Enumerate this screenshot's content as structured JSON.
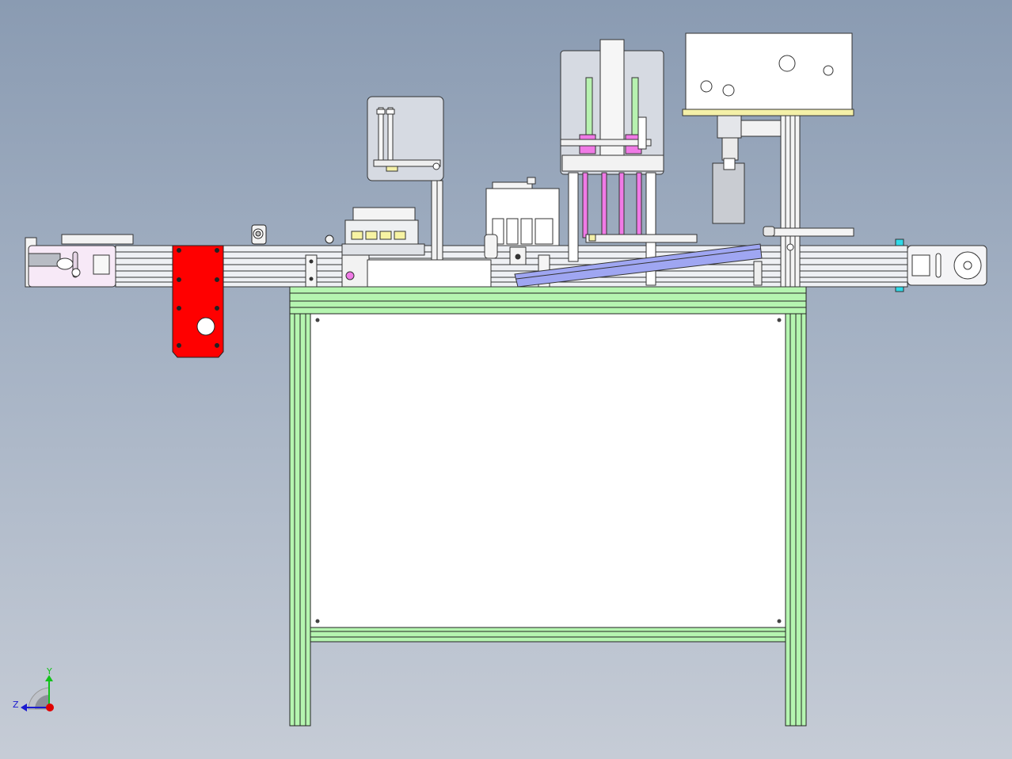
{
  "drawing": {
    "view": "front",
    "background": "#9aa8bc",
    "colors": {
      "frame_green": "#b5f5b0",
      "red_plate": "#ff0000",
      "blue_chute": "#9fa6f2",
      "pink_rod": "#f07ae6",
      "light_green_rod": "#b7f2b0",
      "cyan_marker": "#2fd9e8",
      "housing_grey": "#d6dae2",
      "panel_white": "#ffffff",
      "plate_yellow": "#f4f0a8"
    }
  },
  "triad": {
    "y_label": "Y",
    "z_label": "Z",
    "y_color": "#12c21a",
    "z_color": "#1a1ad0",
    "origin_color": "#e00000"
  }
}
